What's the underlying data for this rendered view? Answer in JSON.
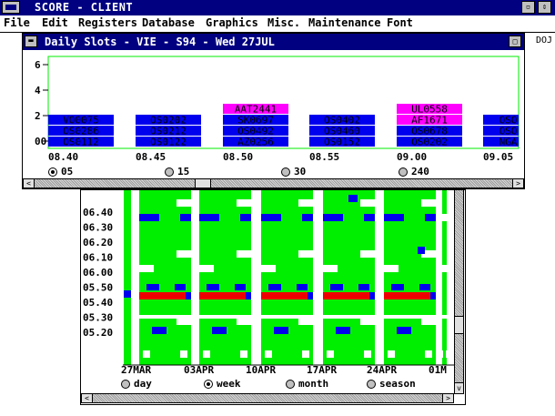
{
  "app": {
    "title": "SCORE - CLIENT",
    "min_glyph": "▫",
    "restore_glyph": "⇕"
  },
  "menu": [
    {
      "label": "File",
      "u": "F"
    },
    {
      "label": "Edit",
      "u": "E"
    },
    {
      "label": "Registers",
      "u": "R"
    },
    {
      "label": "Database",
      "u": "D"
    },
    {
      "label": "Graphics",
      "u": "G"
    },
    {
      "label": "Misc.",
      "u": "M"
    },
    {
      "label": "Maintenance",
      "u": "a"
    },
    {
      "label": "Font",
      "u": "F"
    }
  ],
  "background_text": "DOJ",
  "daily_window": {
    "title": "Daily Slots - VIE - S94 - Wed 27JUL",
    "sys_glyph": "▬",
    "max_glyph": "□",
    "radio_options": [
      {
        "label": "05",
        "selected": true
      },
      {
        "label": "15",
        "selected": false
      },
      {
        "label": "30",
        "selected": false
      },
      {
        "label": "240",
        "selected": false
      }
    ],
    "scroll_left": "<",
    "scroll_right": ">"
  },
  "weekly_window": {
    "radio_options": [
      {
        "label": "day",
        "selected": false
      },
      {
        "label": "week",
        "selected": true
      },
      {
        "label": "month",
        "selected": false
      },
      {
        "label": "season",
        "selected": false
      }
    ],
    "scroll_left": "<",
    "scroll_right": ">",
    "scroll_up": "^",
    "scroll_down": "v"
  },
  "colors": {
    "slot_blue": "#0000ee",
    "slot_magenta": "#ff00ff",
    "green": "#00ee00",
    "red": "#ee0000",
    "title_navy": "#000080"
  },
  "chart_data": [
    {
      "type": "bar",
      "name": "daily-slots",
      "y_ticks": [
        "6",
        "4",
        "2",
        "00"
      ],
      "ylim": [
        0,
        7
      ],
      "categories": [
        "08.40",
        "08.45",
        "08.50",
        "08.55",
        "09.00",
        "09.05"
      ],
      "stacks": [
        [
          {
            "code": "OS0112",
            "color": "blue"
          },
          {
            "code": "OS0286",
            "color": "blue"
          },
          {
            "code": "VO0075",
            "color": "blue"
          }
        ],
        [
          {
            "code": "OS0122",
            "color": "blue"
          },
          {
            "code": "OS0212",
            "color": "blue"
          },
          {
            "code": "OS0202",
            "color": "blue"
          }
        ],
        [
          {
            "code": "AZ0256",
            "color": "blue"
          },
          {
            "code": "OS0492",
            "color": "blue"
          },
          {
            "code": "SK0697",
            "color": "blue"
          },
          {
            "code": "AAT2441",
            "color": "magenta"
          }
        ],
        [
          {
            "code": "OS0152",
            "color": "blue"
          },
          {
            "code": "OS0460",
            "color": "blue"
          },
          {
            "code": "OS0402",
            "color": "blue"
          }
        ],
        [
          {
            "code": "OS0202",
            "color": "blue"
          },
          {
            "code": "OS0678",
            "color": "blue"
          },
          {
            "code": "AF1671",
            "color": "magenta"
          },
          {
            "code": "UL0558",
            "color": "magenta"
          }
        ],
        [
          {
            "code": "NGA",
            "color": "blue"
          },
          {
            "code": "OSO",
            "color": "blue"
          },
          {
            "code": "OSO",
            "color": "blue"
          }
        ]
      ]
    },
    {
      "type": "heatmap",
      "name": "weekly-slots",
      "y_labels": [
        "06.40",
        "06.30",
        "06.20",
        "06.10",
        "06.00",
        "05.50",
        "05.40",
        "05.30",
        "05.20"
      ],
      "x_labels": [
        "27MAR",
        "03APR",
        "10APR",
        "17APR",
        "24APR",
        "01M"
      ],
      "columns": [
        {
          "cells": [
            "B",
            "G",
            "G",
            "G",
            "G",
            "G",
            "G",
            "G",
            "G",
            "G",
            "G",
            "G",
            "G",
            "G",
            "G",
            "G",
            "G",
            "G",
            "G",
            "G",
            "G",
            "G"
          ],
          "marks": {
            "14": "B"
          }
        },
        {
          "cells": [
            "G",
            "B",
            "G",
            "G",
            "G",
            "G",
            "G",
            "G",
            "B",
            "R",
            "G",
            "G",
            "B",
            "G",
            "G",
            "G",
            "G"
          ]
        },
        {
          "cells": [
            "G",
            "B",
            "G",
            "G",
            "G",
            "G",
            "G",
            "G",
            "B",
            "R",
            "G",
            "G",
            "B",
            "G",
            "G",
            "G",
            "G"
          ]
        },
        {
          "cells": [
            "G",
            "B",
            "G",
            "G",
            "G",
            "G",
            "G",
            "G",
            "B",
            "R",
            "G",
            "G",
            "B",
            "G",
            "G",
            "G",
            "G"
          ]
        },
        {
          "cells": [
            "G",
            "B",
            "G",
            "G",
            "G",
            "G",
            "G",
            "G",
            "B",
            "R",
            "G",
            "G",
            "B",
            "G",
            "G",
            "G",
            "G"
          ]
        },
        {
          "cells": [
            "G",
            "B",
            "G",
            "G",
            "G",
            "G",
            "G",
            "G",
            "B",
            "R",
            "G",
            "G",
            "B",
            "G",
            "G",
            "G",
            "G"
          ]
        }
      ]
    }
  ]
}
